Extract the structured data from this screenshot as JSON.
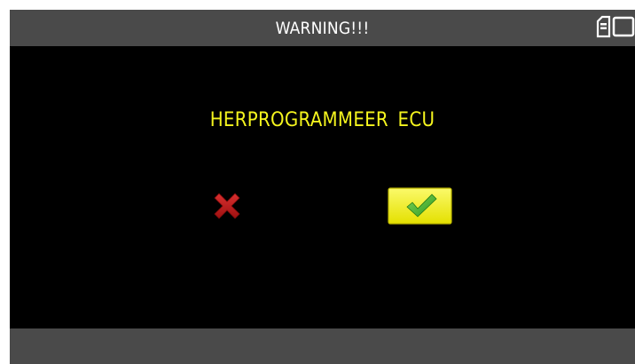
{
  "header": {
    "title": "WARNING!!!"
  },
  "status_icons": [
    "sd-card-icon",
    "battery-icon"
  ],
  "dialog": {
    "message": "HERPROGRAMMEER ECU",
    "cancel_icon": "cross-icon",
    "confirm_icon": "checkmark-icon"
  },
  "colors": {
    "background": "#000000",
    "bar": "#4a4a4a",
    "message_text": "#f5f51e",
    "cancel_red": "#c41a1a",
    "confirm_bg": "#f1ef3a",
    "check_green": "#3cae2c"
  }
}
